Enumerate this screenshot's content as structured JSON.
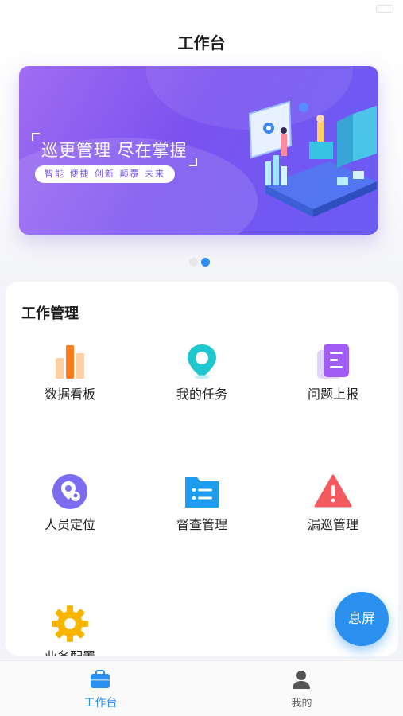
{
  "header": {
    "title": "工作台"
  },
  "banner": {
    "headline": "巡更管理 尽在掌握",
    "tagline": "智能 便捷 创新 颠覆 未来",
    "active_index": 1,
    "count": 2
  },
  "work_section": {
    "title": "工作管理",
    "items": [
      {
        "label": "数据看板",
        "icon": "bar-chart-icon"
      },
      {
        "label": "我的任务",
        "icon": "location-pin-icon"
      },
      {
        "label": "问题上报",
        "icon": "report-document-icon"
      },
      {
        "label": "人员定位",
        "icon": "person-location-icon"
      },
      {
        "label": "督查管理",
        "icon": "folder-list-icon"
      },
      {
        "label": "漏巡管理",
        "icon": "warning-triangle-icon"
      },
      {
        "label": "业务配置",
        "icon": "gear-icon"
      }
    ]
  },
  "fab": {
    "label": "息屏"
  },
  "tabbar": {
    "tabs": [
      {
        "label": "工作台",
        "icon": "briefcase-icon",
        "active": true
      },
      {
        "label": "我的",
        "icon": "user-icon",
        "active": false
      }
    ]
  },
  "colors": {
    "accent": "#2b8ff0",
    "banner_purple": "#7b52ef"
  }
}
